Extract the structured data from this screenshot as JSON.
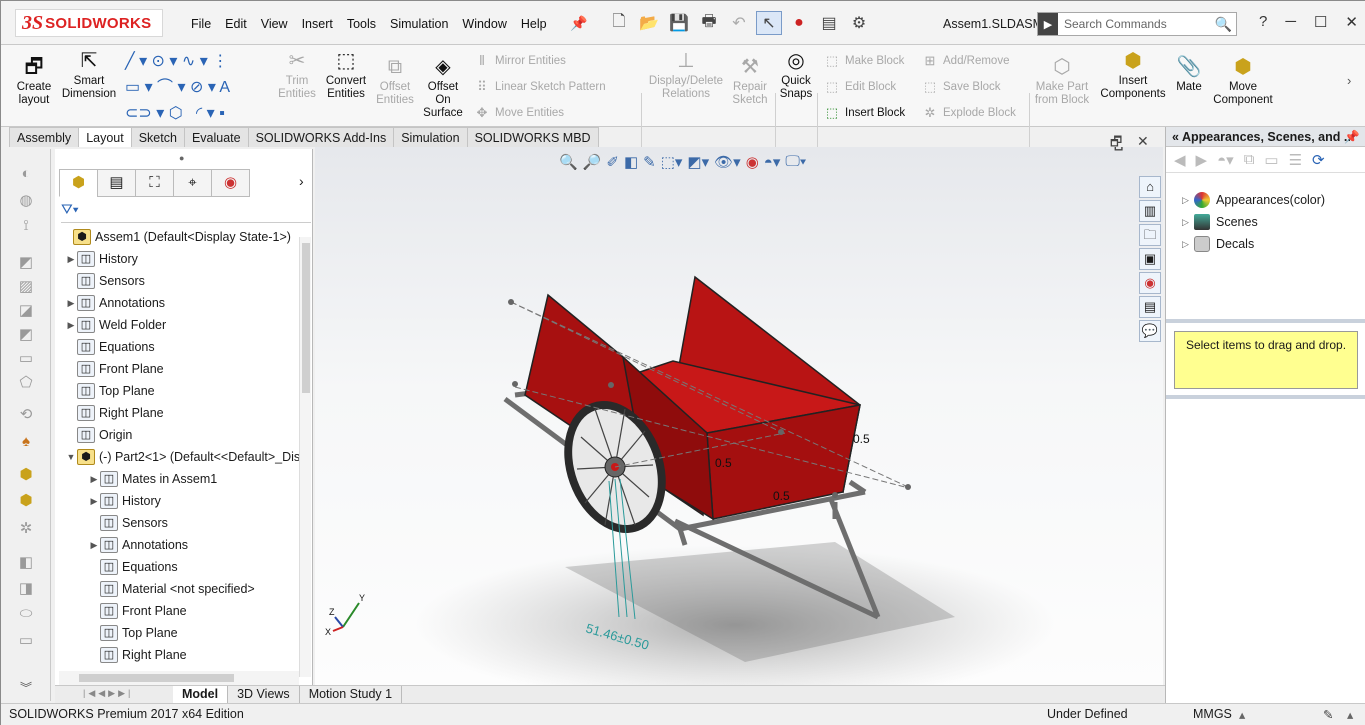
{
  "app": {
    "logo_prefix": "3S",
    "logo_text": "SOLIDWORKS",
    "document_title": "Assem1.SLDASM"
  },
  "menu": [
    "File",
    "Edit",
    "View",
    "Insert",
    "Tools",
    "Simulation",
    "Window",
    "Help"
  ],
  "search": {
    "placeholder": "Search Commands"
  },
  "ribbon": {
    "create_layout": "Create layout",
    "smart_dimension": "Smart Dimension",
    "trim_entities": "Trim Entities",
    "convert_entities": "Convert Entities",
    "offset_entities": "Offset Entities",
    "offset_on_surface": "Offset On Surface",
    "mirror_entities": "Mirror Entities",
    "linear_sketch_pattern": "Linear Sketch Pattern",
    "move_entities": "Move Entities",
    "display_delete_relations": "Display/Delete Relations",
    "repair_sketch": "Repair Sketch",
    "quick_snaps": "Quick Snaps",
    "make_block": "Make Block",
    "edit_block": "Edit Block",
    "insert_block": "Insert Block",
    "add_remove": "Add/Remove",
    "save_block": "Save Block",
    "explode_block": "Explode Block",
    "make_part_from_block": "Make Part from Block",
    "insert_components": "Insert Components",
    "mate": "Mate",
    "move_component": "Move Component"
  },
  "tabs": [
    "Assembly",
    "Layout",
    "Sketch",
    "Evaluate",
    "SOLIDWORKS Add-Ins",
    "Simulation",
    "SOLIDWORKS MBD"
  ],
  "active_tab": "Layout",
  "tree": [
    {
      "label": "Assem1  (Default<Display State-1>)",
      "level": 0,
      "expand": ""
    },
    {
      "label": "History",
      "level": 1,
      "expand": "▶"
    },
    {
      "label": "Sensors",
      "level": 1,
      "expand": ""
    },
    {
      "label": "Annotations",
      "level": 1,
      "expand": "▶"
    },
    {
      "label": "Weld Folder",
      "level": 1,
      "expand": "▶"
    },
    {
      "label": "Equations",
      "level": 1,
      "expand": ""
    },
    {
      "label": "Front Plane",
      "level": 1,
      "expand": ""
    },
    {
      "label": "Top Plane",
      "level": 1,
      "expand": ""
    },
    {
      "label": "Right Plane",
      "level": 1,
      "expand": ""
    },
    {
      "label": "Origin",
      "level": 1,
      "expand": ""
    },
    {
      "label": "(-) Part2<1> (Default<<Default>_Dis",
      "level": 1,
      "expand": "▼"
    },
    {
      "label": "Mates in Assem1",
      "level": 2,
      "expand": "▶"
    },
    {
      "label": "History",
      "level": 2,
      "expand": "▶"
    },
    {
      "label": "Sensors",
      "level": 2,
      "expand": ""
    },
    {
      "label": "Annotations",
      "level": 2,
      "expand": "▶"
    },
    {
      "label": "Equations",
      "level": 2,
      "expand": ""
    },
    {
      "label": "Material <not specified>",
      "level": 2,
      "expand": ""
    },
    {
      "label": "Front Plane",
      "level": 2,
      "expand": ""
    },
    {
      "label": "Top Plane",
      "level": 2,
      "expand": ""
    },
    {
      "label": "Right Plane",
      "level": 2,
      "expand": ""
    }
  ],
  "bottom_tabs": [
    "Model",
    "3D Views",
    "Motion Study 1"
  ],
  "status": {
    "edition": "SOLIDWORKS Premium 2017 x64 Edition",
    "state": "Under Defined",
    "units": "MMGS"
  },
  "viewport": {
    "dim_main": "51.46±0.50",
    "dim_small_1": "0.5",
    "dim_small_2": "0.5",
    "dim_small_3": "0.5",
    "axis_x": "X",
    "axis_y": "Y",
    "axis_z": "Z"
  },
  "task_pane": {
    "title": "Appearances, Scenes, and ...",
    "items": [
      "Appearances(color)",
      "Scenes",
      "Decals"
    ],
    "drop_hint": "Select items to drag and drop."
  },
  "colors": {
    "cart_red": "#b81414",
    "frame": "#8e8e8e",
    "dim": "#2a9a9a",
    "accent": "#d22222"
  }
}
